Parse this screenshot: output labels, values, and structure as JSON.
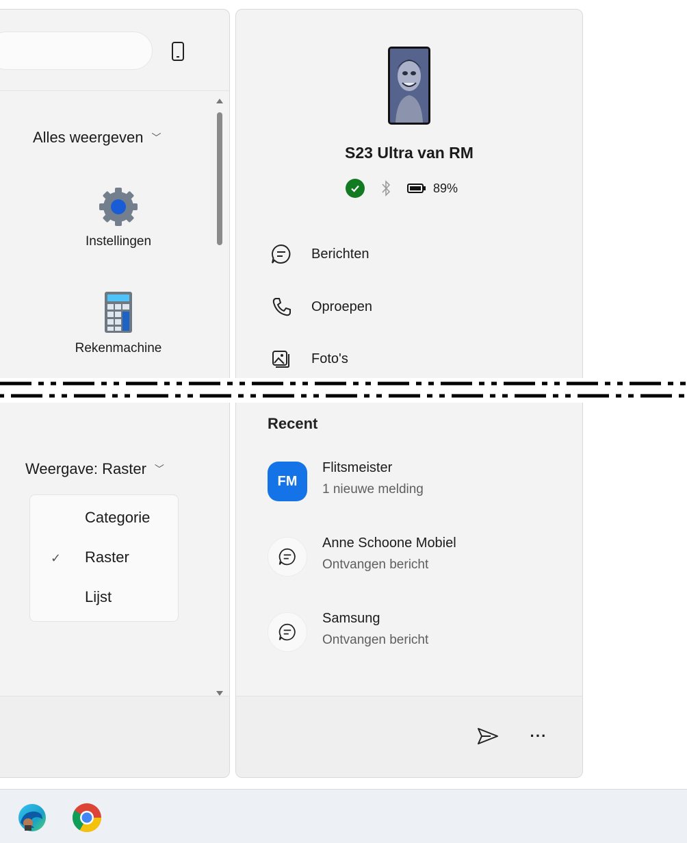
{
  "left_panel": {
    "show_all_label": "Alles weergeven",
    "apps": [
      {
        "name": "Instellingen",
        "icon": "settings-gear-icon"
      },
      {
        "name": "Rekenmachine",
        "icon": "calculator-icon"
      }
    ],
    "view_dropdown_label": "Weergave: Raster",
    "view_options": [
      {
        "label": "Categorie",
        "checked": false
      },
      {
        "label": "Raster",
        "checked": true
      },
      {
        "label": "Lijst",
        "checked": false
      }
    ]
  },
  "phone_panel": {
    "device_name": "S23 Ultra van RM",
    "battery": "89%",
    "nav": [
      {
        "label": "Berichten",
        "icon": "message-icon"
      },
      {
        "label": "Oproepen",
        "icon": "phone-call-icon"
      },
      {
        "label": "Foto's",
        "icon": "photos-icon"
      }
    ],
    "recent_title": "Recent",
    "recent": [
      {
        "title": "Flitsmeister",
        "subtitle": "1 nieuwe melding",
        "logo_text": "FM"
      },
      {
        "title": "Anne Schoone Mobiel",
        "subtitle": "Ontvangen bericht"
      },
      {
        "title": "Samsung",
        "subtitle": "Ontvangen bericht"
      }
    ]
  },
  "colors": {
    "accent_blue": "#1473e6",
    "connected_green": "#127b22"
  },
  "taskbar": {
    "icons": [
      "edge-browser-icon",
      "chrome-browser-icon"
    ]
  }
}
